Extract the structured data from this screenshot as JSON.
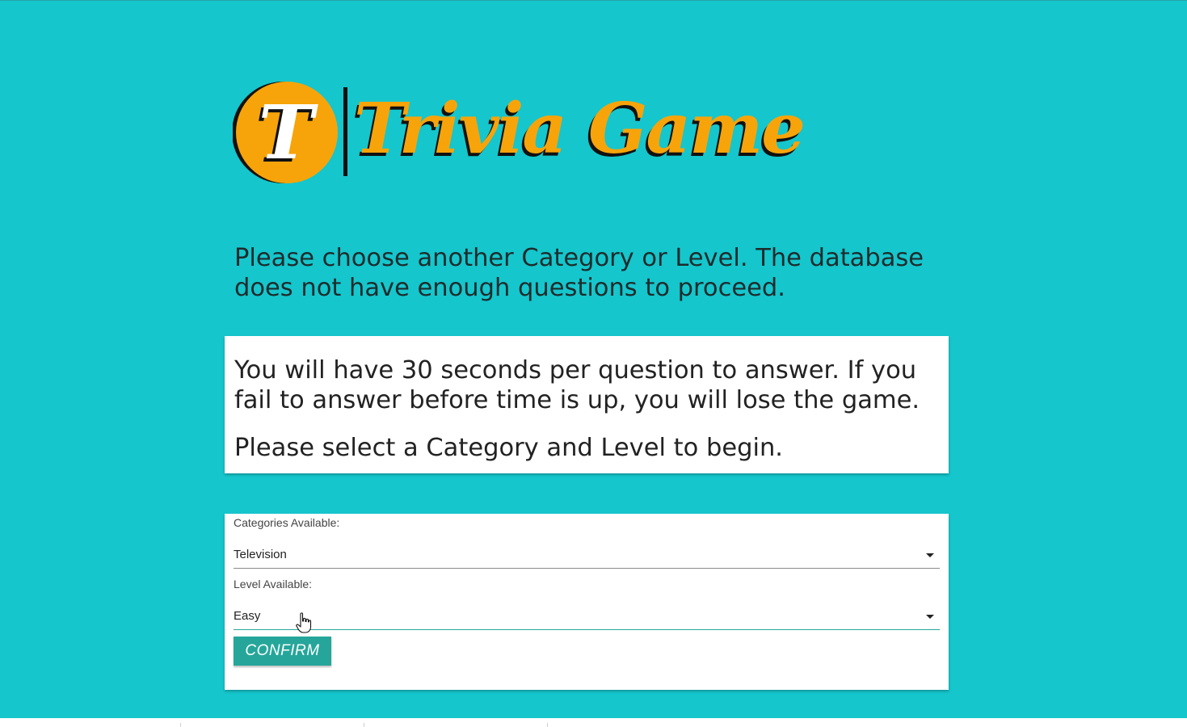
{
  "logo": {
    "badge_letter": "T",
    "title": "Trivia Game",
    "colors": {
      "primary": "#f7a40a",
      "outline": "#111111"
    }
  },
  "warning_text": "Please choose another Category or Level. The database does not have enough questions to proceed.",
  "info": {
    "paragraph1": "You will have 30 seconds per question to answer. If you fail to answer before time is up, you will lose the game.",
    "paragraph2": "Please select a Category and Level to begin."
  },
  "form": {
    "category": {
      "label": "Categories Available:",
      "value": "Television"
    },
    "level": {
      "label": "Level Available:",
      "value": "Easy"
    },
    "confirm_label": "CONFIRM"
  },
  "colors": {
    "background": "#15c6cc",
    "accent": "#26a69a",
    "card": "#ffffff"
  },
  "icons": [
    "caret-down-icon",
    "hand-pointer-icon"
  ]
}
